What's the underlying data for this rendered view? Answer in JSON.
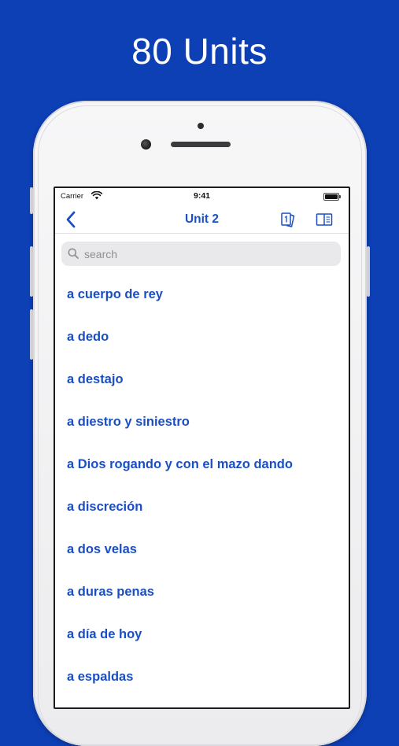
{
  "promo": {
    "title": "80 Units"
  },
  "status_bar": {
    "carrier": "Carrier",
    "time": "9:41"
  },
  "nav": {
    "title": "Unit 2",
    "back_icon": "chevron-left-icon",
    "flashcards_icon": "flashcards-icon",
    "book_icon": "book-icon"
  },
  "search": {
    "placeholder": "search",
    "value": ""
  },
  "list": {
    "items": [
      {
        "label": "a cuerpo de rey"
      },
      {
        "label": "a dedo"
      },
      {
        "label": "a destajo"
      },
      {
        "label": "a diestro y siniestro"
      },
      {
        "label": "a Dios rogando y con el mazo dando"
      },
      {
        "label": "a discreción"
      },
      {
        "label": "a dos velas"
      },
      {
        "label": "a duras penas"
      },
      {
        "label": "a día de hoy"
      },
      {
        "label": "a espaldas"
      }
    ]
  },
  "colors": {
    "background": "#0d3fb5",
    "accent": "#1a4fc4"
  }
}
